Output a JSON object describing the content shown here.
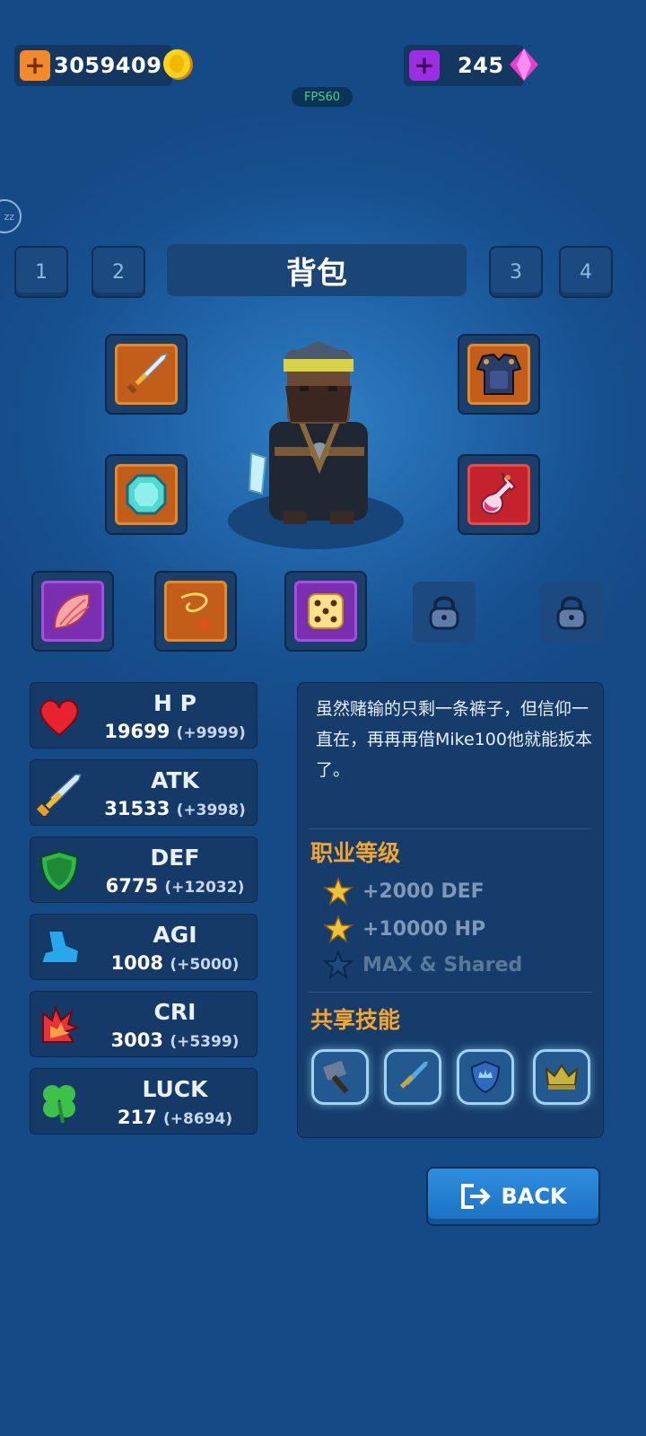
{
  "currency": {
    "gold": "3059409",
    "gems": "245",
    "gold_plus": "+",
    "gem_plus": "+"
  },
  "fps": "FPS60",
  "sleep_badge": "zz",
  "tabs": [
    "1",
    "2",
    "3",
    "4"
  ],
  "title": "背包",
  "equipment": {
    "left": [
      "sword-icon",
      "diamond-gem-icon"
    ],
    "right": [
      "armor-icon",
      "potion-icon"
    ],
    "accessories": [
      "feather-icon",
      "amulet-icon",
      "dice-icon",
      "lock-icon",
      "lock-icon"
    ]
  },
  "stats": [
    {
      "name": "H P",
      "value": "19699",
      "bonus": "(+9999)",
      "icon": "heart-icon"
    },
    {
      "name": "ATK",
      "value": "31533",
      "bonus": "(+3998)",
      "icon": "sword-icon"
    },
    {
      "name": "DEF",
      "value": "6775",
      "bonus": "(+12032)",
      "icon": "shield-icon"
    },
    {
      "name": "AGI",
      "value": "1008",
      "bonus": "(+5000)",
      "icon": "boot-icon"
    },
    {
      "name": "CRI",
      "value": "3003",
      "bonus": "(+5399)",
      "icon": "burst-icon"
    },
    {
      "name": "LUCK",
      "value": "217",
      "bonus": "(+8694)",
      "icon": "clover-icon"
    }
  ],
  "description": "虽然赌输的只剩一条裤子，但信仰一直在，再再再借Mike100他就能扳本了。",
  "rank_section": {
    "title": "职业等级",
    "items": [
      "+2000 DEF",
      "+10000 HP",
      "MAX & Shared"
    ]
  },
  "skill_section": {
    "title": "共享技能",
    "skills": [
      "hammer-icon",
      "sword-icon",
      "crown-shield-icon",
      "crown-icon"
    ]
  },
  "back_label": "BACK",
  "colors": {
    "accent_orange": "#f2a531",
    "bg_blue": "#1f62a6",
    "panel": "#163c6b"
  }
}
